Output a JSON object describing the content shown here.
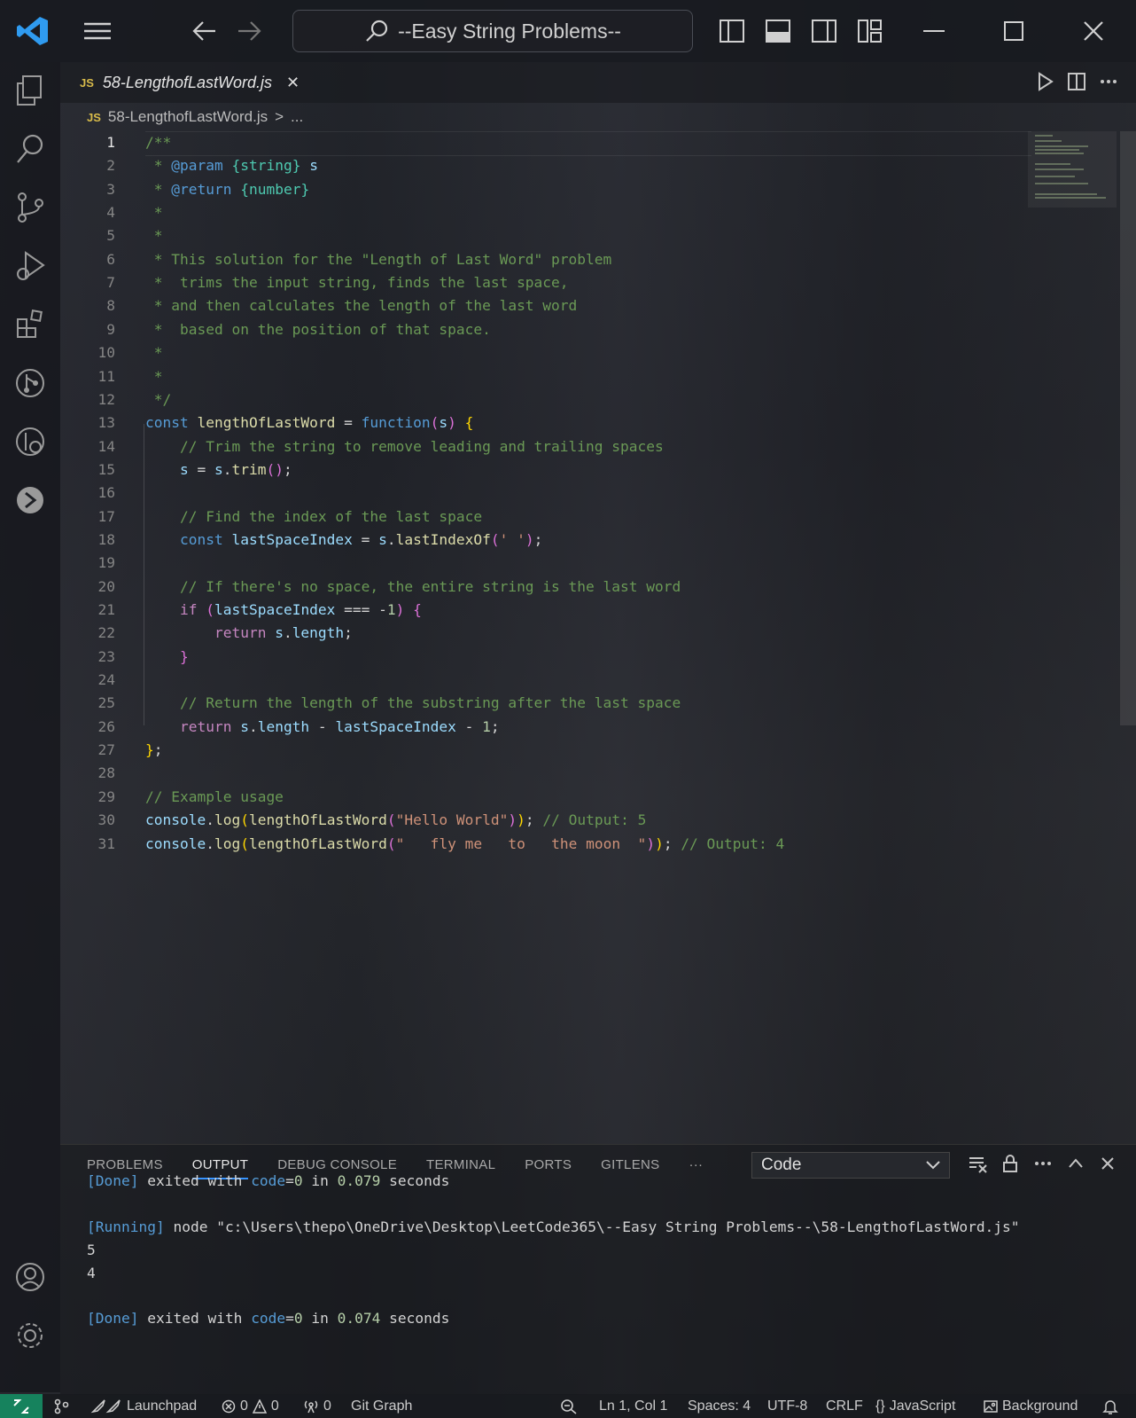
{
  "title_bar": {
    "search_text": "--Easy String Problems--"
  },
  "tab": {
    "badge": "JS",
    "label": "58-LengthofLastWord.js",
    "close": "✕"
  },
  "breadcrumb": {
    "badge": "JS",
    "file": "58-LengthofLastWord.js",
    "separator": ">",
    "more": "..."
  },
  "editor": {
    "active_line": 1,
    "lines": [
      {
        "n": "1",
        "tokens": [
          [
            "c-doc",
            "/**"
          ]
        ]
      },
      {
        "n": "2",
        "tokens": [
          [
            "c-doc",
            " * "
          ],
          [
            "c-tag",
            "@param"
          ],
          [
            "c-doc",
            " "
          ],
          [
            "c-type",
            "{string}"
          ],
          [
            "c-var",
            " s"
          ]
        ]
      },
      {
        "n": "3",
        "tokens": [
          [
            "c-doc",
            " * "
          ],
          [
            "c-tag",
            "@return"
          ],
          [
            "c-doc",
            " "
          ],
          [
            "c-type",
            "{number}"
          ]
        ]
      },
      {
        "n": "4",
        "tokens": [
          [
            "c-doc",
            " *"
          ]
        ]
      },
      {
        "n": "5",
        "tokens": [
          [
            "c-doc",
            " *"
          ]
        ]
      },
      {
        "n": "6",
        "tokens": [
          [
            "c-doc",
            " * This solution for the \"Length of Last Word\" problem"
          ]
        ]
      },
      {
        "n": "7",
        "tokens": [
          [
            "c-doc",
            " *  trims the input string, finds the last space,"
          ]
        ]
      },
      {
        "n": "8",
        "tokens": [
          [
            "c-doc",
            " * and then calculates the length of the last word"
          ]
        ]
      },
      {
        "n": "9",
        "tokens": [
          [
            "c-doc",
            " *  based on the position of that space."
          ]
        ]
      },
      {
        "n": "10",
        "tokens": [
          [
            "c-doc",
            " *"
          ]
        ]
      },
      {
        "n": "11",
        "tokens": [
          [
            "c-doc",
            " *"
          ]
        ]
      },
      {
        "n": "12",
        "tokens": [
          [
            "c-doc",
            " */"
          ]
        ]
      },
      {
        "n": "13",
        "tokens": [
          [
            "c-kw",
            "const "
          ],
          [
            "c-fn",
            "lengthOfLastWord"
          ],
          [
            "c-plain",
            " = "
          ],
          [
            "c-kw",
            "function"
          ],
          [
            "c-br2",
            "("
          ],
          [
            "c-var",
            "s"
          ],
          [
            "c-br2",
            ")"
          ],
          [
            "c-plain",
            " "
          ],
          [
            "c-br1",
            "{"
          ]
        ]
      },
      {
        "n": "14",
        "tokens": [
          [
            "c-com",
            "    // Trim the string to remove leading and trailing spaces"
          ]
        ]
      },
      {
        "n": "15",
        "tokens": [
          [
            "c-var",
            "    s"
          ],
          [
            "c-plain",
            " = "
          ],
          [
            "c-var",
            "s"
          ],
          [
            "c-plain",
            "."
          ],
          [
            "c-fn",
            "trim"
          ],
          [
            "c-br2",
            "()"
          ],
          [
            "c-plain",
            ";"
          ]
        ]
      },
      {
        "n": "16",
        "tokens": [
          [
            "c-plain",
            ""
          ]
        ]
      },
      {
        "n": "17",
        "tokens": [
          [
            "c-com",
            "    // Find the index of the last space"
          ]
        ]
      },
      {
        "n": "18",
        "tokens": [
          [
            "c-kw",
            "    const "
          ],
          [
            "c-var",
            "lastSpaceIndex"
          ],
          [
            "c-plain",
            " = "
          ],
          [
            "c-var",
            "s"
          ],
          [
            "c-plain",
            "."
          ],
          [
            "c-fn",
            "lastIndexOf"
          ],
          [
            "c-br2",
            "("
          ],
          [
            "c-str",
            "' '"
          ],
          [
            "c-br2",
            ")"
          ],
          [
            "c-plain",
            ";"
          ]
        ]
      },
      {
        "n": "19",
        "tokens": [
          [
            "c-plain",
            ""
          ]
        ]
      },
      {
        "n": "20",
        "tokens": [
          [
            "c-com",
            "    // If there's no space, the entire string is the last word"
          ]
        ]
      },
      {
        "n": "21",
        "tokens": [
          [
            "c-ctl",
            "    if "
          ],
          [
            "c-br2",
            "("
          ],
          [
            "c-var",
            "lastSpaceIndex"
          ],
          [
            "c-plain",
            " === -"
          ],
          [
            "c-num",
            "1"
          ],
          [
            "c-br2",
            ")"
          ],
          [
            "c-plain",
            " "
          ],
          [
            "c-br2",
            "{"
          ]
        ]
      },
      {
        "n": "22",
        "tokens": [
          [
            "c-ctl",
            "        return "
          ],
          [
            "c-var",
            "s"
          ],
          [
            "c-plain",
            "."
          ],
          [
            "c-var",
            "length"
          ],
          [
            "c-plain",
            ";"
          ]
        ]
      },
      {
        "n": "23",
        "tokens": [
          [
            "c-br2",
            "    }"
          ]
        ]
      },
      {
        "n": "24",
        "tokens": [
          [
            "c-plain",
            ""
          ]
        ]
      },
      {
        "n": "25",
        "tokens": [
          [
            "c-com",
            "    // Return the length of the substring after the last space"
          ]
        ]
      },
      {
        "n": "26",
        "tokens": [
          [
            "c-ctl",
            "    return "
          ],
          [
            "c-var",
            "s"
          ],
          [
            "c-plain",
            "."
          ],
          [
            "c-var",
            "length"
          ],
          [
            "c-plain",
            " - "
          ],
          [
            "c-var",
            "lastSpaceIndex"
          ],
          [
            "c-plain",
            " - "
          ],
          [
            "c-num",
            "1"
          ],
          [
            "c-plain",
            ";"
          ]
        ]
      },
      {
        "n": "27",
        "tokens": [
          [
            "c-br1",
            "}"
          ],
          [
            "c-plain",
            ";"
          ]
        ]
      },
      {
        "n": "28",
        "tokens": [
          [
            "c-plain",
            ""
          ]
        ]
      },
      {
        "n": "29",
        "tokens": [
          [
            "c-com",
            "// Example usage"
          ]
        ]
      },
      {
        "n": "30",
        "tokens": [
          [
            "c-var",
            "console"
          ],
          [
            "c-plain",
            "."
          ],
          [
            "c-fn",
            "log"
          ],
          [
            "c-br1",
            "("
          ],
          [
            "c-fn",
            "lengthOfLastWord"
          ],
          [
            "c-br2",
            "("
          ],
          [
            "c-str",
            "\"Hello World\""
          ],
          [
            "c-br2",
            ")"
          ],
          [
            "c-br1",
            ")"
          ],
          [
            "c-plain",
            "; "
          ],
          [
            "c-com",
            "// Output: 5"
          ]
        ]
      },
      {
        "n": "31",
        "tokens": [
          [
            "c-var",
            "console"
          ],
          [
            "c-plain",
            "."
          ],
          [
            "c-fn",
            "log"
          ],
          [
            "c-br1",
            "("
          ],
          [
            "c-fn",
            "lengthOfLastWord"
          ],
          [
            "c-br2",
            "("
          ],
          [
            "c-str",
            "\"   fly me   to   the moon  \""
          ],
          [
            "c-br2",
            ")"
          ],
          [
            "c-br1",
            ")"
          ],
          [
            "c-plain",
            "; "
          ],
          [
            "c-com",
            "// Output: 4"
          ]
        ]
      }
    ]
  },
  "panel": {
    "tabs": [
      "PROBLEMS",
      "OUTPUT",
      "DEBUG CONSOLE",
      "TERMINAL",
      "PORTS",
      "GITLENS"
    ],
    "active_tab": "OUTPUT",
    "more": "···",
    "channel": "Code",
    "output": [
      [
        [
          "c-tag",
          "[Done]"
        ],
        [
          "c-plain",
          " exited with "
        ],
        [
          "c-tag",
          "code"
        ],
        [
          "c-plain",
          "="
        ],
        [
          "c-num",
          "0"
        ],
        [
          "c-plain",
          " in "
        ],
        [
          "c-num",
          "0.079"
        ],
        [
          "c-plain",
          " seconds"
        ]
      ],
      [],
      [
        [
          "c-tag",
          "[Running]"
        ],
        [
          "c-plain",
          " node \"c:\\Users\\thepo\\OneDrive\\Desktop\\LeetCode365\\--Easy String Problems--\\58-LengthofLastWord.js\""
        ]
      ],
      [
        [
          "c-plain",
          "5"
        ]
      ],
      [
        [
          "c-plain",
          "4"
        ]
      ],
      [],
      [
        [
          "c-tag",
          "[Done]"
        ],
        [
          "c-plain",
          " exited with "
        ],
        [
          "c-tag",
          "code"
        ],
        [
          "c-plain",
          "="
        ],
        [
          "c-num",
          "0"
        ],
        [
          "c-plain",
          " in "
        ],
        [
          "c-num",
          "0.074"
        ],
        [
          "c-plain",
          " seconds"
        ]
      ]
    ]
  },
  "status_bar": {
    "launchpad": "Launchpad",
    "errors": "0",
    "warnings": "0",
    "ports": "0",
    "git_graph": "Git Graph",
    "position": "Ln 1, Col 1",
    "spaces": "Spaces: 4",
    "encoding": "UTF-8",
    "eol": "CRLF",
    "language": "JavaScript",
    "background": "Background"
  }
}
